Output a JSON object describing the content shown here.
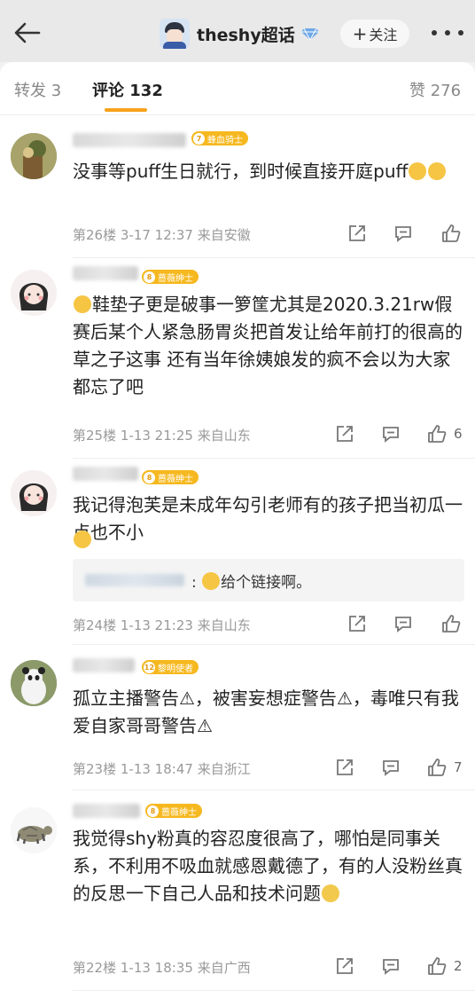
{
  "header": {
    "title": "theshy超话",
    "follow_label": "关注"
  },
  "tabs": [
    {
      "label": "转发 3"
    },
    {
      "label": "评论 132"
    },
    {
      "label": "赞 276"
    }
  ],
  "comments": [
    {
      "badge": "蜂血骑士",
      "badge_level": "7",
      "text": "没事等puff生日就行，到时候直接开庭puff",
      "floor": "第26楼",
      "time": "3-17 12:37",
      "location": "来自安徽",
      "likes": ""
    },
    {
      "badge": "蔷薇绅士",
      "badge_level": "8",
      "text": "鞋垫子更是破事一箩筐尤其是2020.3.21rw假赛后某个人紧急肠胃炎把首发让给年前打的很高的草之子这事 还有当年徐姨娘发的疯不会以为大家都忘了吧",
      "floor": "第25楼",
      "time": "1-13 21:25",
      "location": "来自山东",
      "likes": "6"
    },
    {
      "badge": "蔷薇绅士",
      "badge_level": "8",
      "text": "我记得泡芙是未成年勾引老师有的孩子把当初瓜一点也不小",
      "floor": "第24楼",
      "time": "1-13 21:23",
      "location": "来自山东",
      "likes": "",
      "reply": "给个链接啊。"
    },
    {
      "badge": "黎明使者",
      "badge_level": "12",
      "text": "孤立主播警告⚠，被害妄想症警告⚠，毒唯只有我爱自家哥哥警告⚠",
      "floor": "第23楼",
      "time": "1-13 18:47",
      "location": "来自浙江",
      "likes": "7"
    },
    {
      "badge": "蔷薇绅士",
      "badge_level": "8",
      "text": "我觉得shy粉真的容忍度很高了，哪怕是同事关系，不利用不吸血就感恩戴德了，有的人没粉丝真的反思一下自己人品和技术问题",
      "floor": "第22楼",
      "time": "1-13 18:35",
      "location": "来自广西",
      "likes": "2"
    }
  ],
  "colors": {
    "accent": "#f7a21b",
    "badge": "#f6b81f"
  }
}
